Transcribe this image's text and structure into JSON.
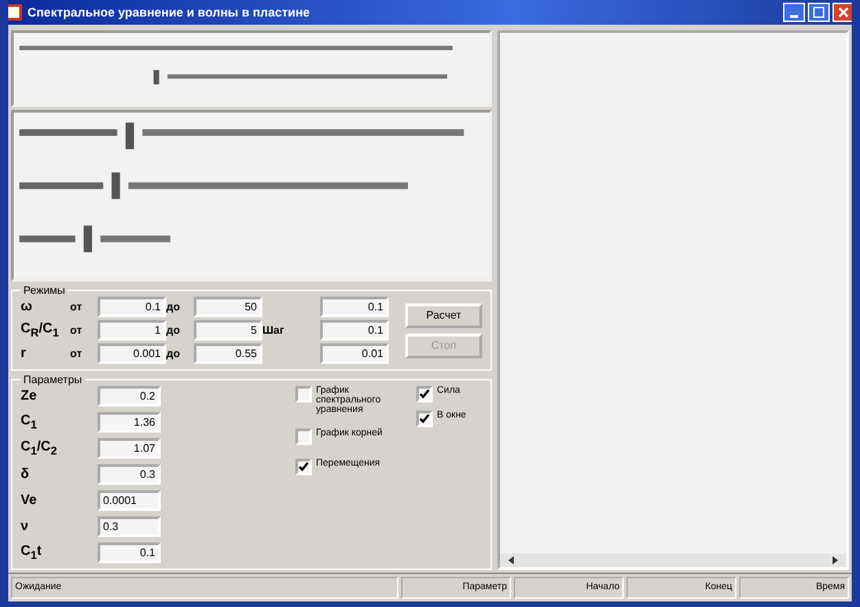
{
  "window": {
    "title": "Спектральное уравнение и волны в пластине"
  },
  "modes": {
    "title": "Режимы",
    "step_label": "Шаг",
    "rows": [
      {
        "label": "ω",
        "from_label": "от",
        "from": "0.1",
        "to_label": "до",
        "to": "50",
        "step": "0.1"
      },
      {
        "label": "C$_{R}$/C$_{1}$",
        "from_label": "от",
        "from": "1",
        "to_label": "до",
        "to": "5",
        "step": "0.1"
      },
      {
        "label": "r",
        "from_label": "от",
        "from": "0.001",
        "to_label": "до",
        "to": "0.55",
        "step": "0.01"
      }
    ],
    "buttons": [
      {
        "label": "Расчет",
        "disabled": false
      },
      {
        "label": "Стоп",
        "disabled": true
      }
    ]
  },
  "params": {
    "title": "Параметры",
    "rows": [
      {
        "label": "Ze",
        "value": "0.2",
        "kind": "numeric"
      },
      {
        "label": "C$_{1}$",
        "value": "1.36",
        "kind": "numeric"
      },
      {
        "label": "C$_{1}$/C$_{2}$",
        "value": "1.07",
        "kind": "numeric"
      },
      {
        "label": "δ",
        "value": "0.3",
        "kind": "numeric"
      },
      {
        "label": "Ve",
        "value": "0.0001",
        "kind": "plain"
      },
      {
        "label": "ν",
        "value": "0.3",
        "kind": "plain"
      },
      {
        "label": "C$_{1}$t",
        "value": "0.1",
        "kind": "numeric"
      }
    ],
    "checks": [
      {
        "label": "График спектрального уравнения",
        "checked": false
      },
      {
        "label": "График корней",
        "checked": false
      },
      {
        "label": "Перемещения",
        "checked": true
      }
    ],
    "side_checks": [
      {
        "label": "Сила",
        "checked": true
      },
      {
        "label": "В окне",
        "checked": true
      }
    ]
  },
  "status_bar": [
    {
      "text": "Ожидание"
    },
    {
      "text": "Параметр"
    },
    {
      "text": "Начало"
    },
    {
      "text": "Конец"
    },
    {
      "text": "Время"
    }
  ]
}
